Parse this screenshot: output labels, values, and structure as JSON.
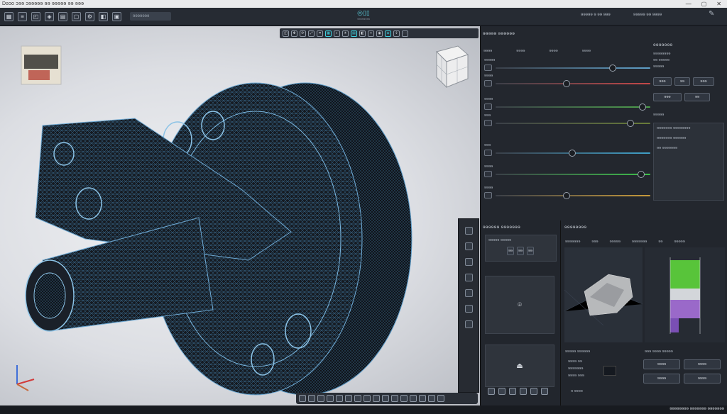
{
  "window": {
    "title": "Dǝɔo  ɔɘɘ ɔɘɘɘɘɘ  ɘɘ ɘɘɘɘɘ ɘɘ  ɘɘɘ",
    "controls": [
      "—",
      "▢",
      "✕"
    ]
  },
  "toolbar": {
    "search_placeholder": "ɘɘɘɘɘɘɘ"
  },
  "logo": {
    "mark": "◎▯▯",
    "sub": "ɘɘɘɘɘɘɘɘ"
  },
  "top_right": {
    "left_text": "ɘɘɘɘɘ ɘ ɘɘ ɘɘɘ",
    "right_text": "ɘɘɘɘɘ ɘɘ ɘɘɘɘ"
  },
  "viewport": {
    "mode": "wireframe",
    "accent": "#56b8d6"
  },
  "right_panel": {
    "title": "ɘɘɘɘɘ ɘɘɘɘɘɘ",
    "tabs": [
      "ɘɘɘɘ",
      "ɘɘɘɘ",
      "ɘɘɘɘ",
      "ɘɘɘɘ"
    ],
    "sliders": [
      {
        "label": "ɘɘɘɘɘ",
        "value": 0.76,
        "color": "#5fa0c9"
      },
      {
        "label": "ɘɘɘɘ",
        "value": 0.45,
        "color": "#c54848"
      },
      {
        "label": "ɘɘɘɘ",
        "value": 0.96,
        "color": "#4e9f4c"
      },
      {
        "label": "ɘɘɘ",
        "value": 0.88,
        "color": "#6a7d3a"
      },
      {
        "label": "ɘɘɘ",
        "value": 0.49,
        "color": "#3fa0c8"
      },
      {
        "label": "ɘɘɘɘ",
        "value": 0.95,
        "color": "#3fc04a"
      },
      {
        "label": "ɘɘɘɘ",
        "value": 0.45,
        "color": "#c79a3b"
      }
    ]
  },
  "sub_panel": {
    "title": "ɘɘɘɘɘɘɘ",
    "line1": "ɘɘɘɘɘɘɘɘ",
    "line2": "ɘɘ ɘɘɘɘɘ",
    "line3": "ɘɘɘɘɘ",
    "btns": [
      "ɘɘɘ",
      "ɘɘ",
      "ɘɘɘ",
      "ɘɘɘ",
      "ɘɘ"
    ],
    "section": "ɘɘɘɘɘ",
    "rows": [
      "ɘɘɘɘɘɘɘ ɘɘɘɘɘɘɘɘ",
      "ɘɘɘɘɘɘɘ ɘɘɘɘɘɘ",
      "ɘɘ ɘɘɘɘɘɘɘ"
    ]
  },
  "bottom_left": {
    "title": "ɘɘɘɘɘɘ ɘɘɘɘɘɘɘ",
    "row": "ɘɘɘɘɘ ɘɘɘɘɘ",
    "chips": [
      "ɘɘ",
      "ɘɘ",
      "ɘɘ"
    ]
  },
  "bottom_right": {
    "title": "ɘɘɘɘɘɘɘɘ",
    "col_heads": [
      "ɘɘɘɘɘɘɘ",
      "ɘɘɘ",
      "ɘɘɘɘɘ",
      "ɘɘɘɘɘɘɘ",
      "ɘɘ",
      "ɘɘɘɘɘ"
    ],
    "sec1": "ɘɘɘɘɘ ɘɘɘɘɘɘ",
    "sec2": "ɘɘɘ ɘɘɘɘ ɘɘɘɘɘ",
    "values": [
      "ɘɘɘɘ ɘɘ",
      "ɘɘɘɘɘɘɘ",
      "ɘɘɘɘ ɘɘɘ"
    ],
    "btns": [
      "ɘɘɘɘ",
      "ɘɘɘɘ",
      "ɘɘɘɘ",
      "ɘɘɘɘ"
    ],
    "footer": "ɘ ɘɘɘɘ"
  },
  "status": {
    "right": "ɘɘɘɘɘɘɘɘ ɘɘɘɘɘɘɘ ɘɘɘɘɘɘɘ"
  }
}
